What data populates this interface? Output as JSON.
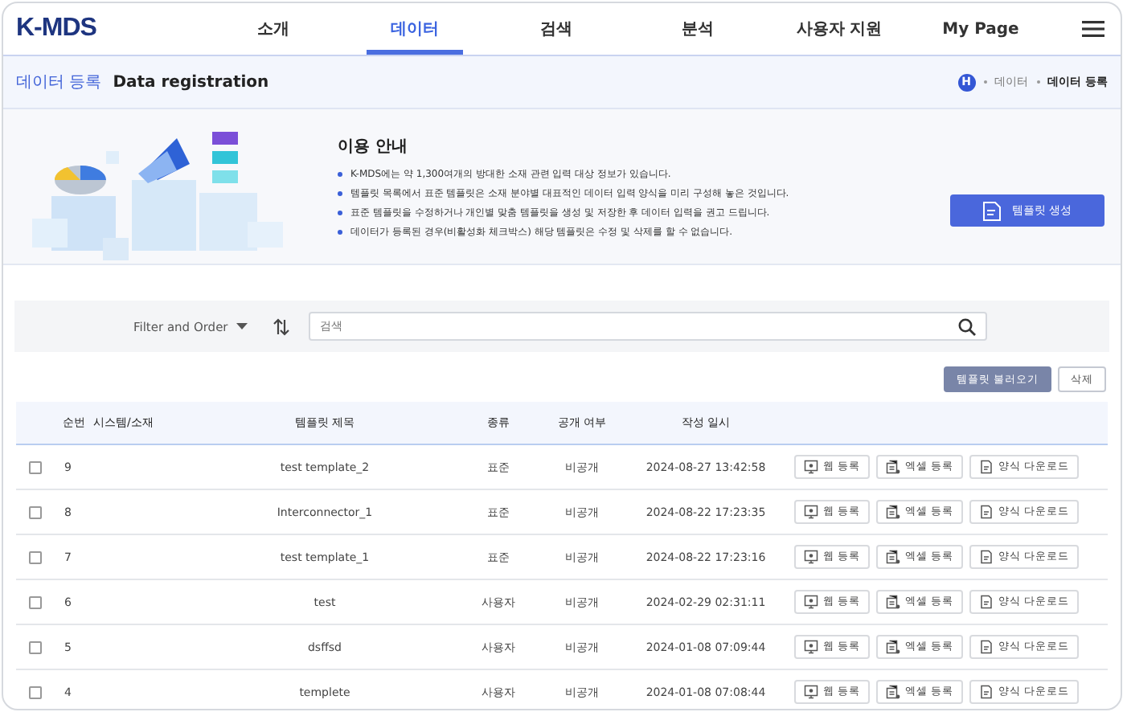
{
  "logo": "K-MDS",
  "nav": [
    {
      "label": "소개",
      "selected": false
    },
    {
      "label": "데이터",
      "selected": true
    },
    {
      "label": "검색",
      "selected": false
    },
    {
      "label": "분석",
      "selected": false
    },
    {
      "label": "사용자 지원",
      "selected": false
    },
    {
      "label": "My Page",
      "selected": false
    }
  ],
  "page_title": {
    "korean": "데이터 등록",
    "english": "Data registration"
  },
  "breadcrumb": {
    "home_badge": "H",
    "items": [
      "데이터",
      "데이터 등록"
    ]
  },
  "guide": {
    "title": "이용 안내",
    "items": [
      "K-MDS에는 약 1,300여개의 방대한 소재 관련 입력 대상 정보가 있습니다.",
      "템플릿 목록에서 표준 템플릿은 소재 분야별 대표적인 데이터 입력 양식을 미리 구성해 놓은 것입니다.",
      "표준 템플릿을 수정하거나 개인별 맞춤 템플릿을 생성 및 저장한 후 데이터 입력을 권고 드립니다.",
      "데이터가 등록된 경우(비활성화 체크박스) 해당 템플릿은 수정 및 삭제를 할 수 없습니다."
    ],
    "button": "템플릿 생성"
  },
  "filter": {
    "label": "Filter and Order",
    "search_placeholder": "검색"
  },
  "actions": [
    "템플릿 불러오기",
    "삭제"
  ],
  "table": {
    "columns": [
      "순번",
      "시스템/소재",
      "템플릿 제목",
      "종류",
      "공개 여부",
      "작성 일시"
    ],
    "rows": [
      {
        "checked": false,
        "no": "9",
        "title": "test template_2",
        "type": "표준",
        "visibility": "비공개",
        "date": "2024-08-27 13:42:58",
        "buttons": [
          "웹 등록",
          "엑셀 등록",
          "양식 다운로드"
        ]
      },
      {
        "checked": false,
        "no": "8",
        "title": "Interconnector_1",
        "type": "표준",
        "visibility": "비공개",
        "date": "2024-08-22 17:23:35",
        "buttons": [
          "웹 등록",
          "엑셀 등록",
          "양식 다운로드"
        ]
      },
      {
        "checked": false,
        "no": "7",
        "title": "test template_1",
        "type": "표준",
        "visibility": "비공개",
        "date": "2024-08-22 17:23:16",
        "buttons": [
          "웹 등록",
          "엑셀 등록",
          "양식 다운로드"
        ]
      },
      {
        "checked": false,
        "no": "6",
        "title": "test",
        "type": "사용자",
        "visibility": "비공개",
        "date": "2024-02-29 02:31:11",
        "buttons": [
          "웹 등록",
          "엑셀 등록",
          "양식 다운로드"
        ]
      },
      {
        "checked": false,
        "no": "5",
        "title": "dsffsd",
        "type": "사용자",
        "visibility": "비공개",
        "date": "2024-01-08 07:09:44",
        "buttons": [
          "웹 등록",
          "엑셀 등록",
          "양식 다운로드"
        ]
      },
      {
        "checked": false,
        "no": "4",
        "title": "templete",
        "type": "사용자",
        "visibility": "비공개",
        "date": "2024-01-08 07:08:44",
        "buttons": [
          "웹 등록",
          "엑셀 등록",
          "양식 다운로드"
        ]
      }
    ]
  }
}
